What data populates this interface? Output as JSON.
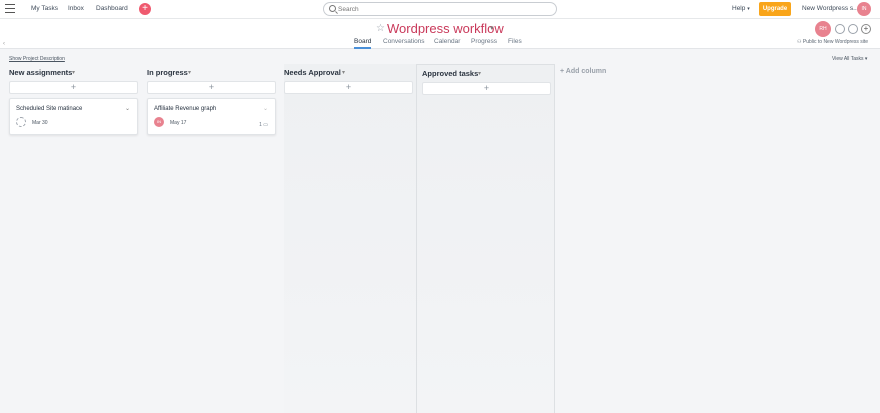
{
  "topbar": {
    "nav": [
      "My Tasks",
      "Inbox",
      "Dashboard"
    ],
    "search_placeholder": "Search",
    "help_label": "Help",
    "upgrade_label": "Upgrade",
    "workspace_label": "New Wordpress s...",
    "avatar_initials": "IN"
  },
  "project": {
    "title": "Wordpress workflow",
    "tabs": [
      "Board",
      "Conversations",
      "Calendar",
      "Progress",
      "Files"
    ],
    "active_tab": "Board",
    "member_initials": "RH",
    "public_label": "Public to New Wordpress site"
  },
  "board": {
    "show_description": "Show Project Description",
    "view_all": "View All Tasks",
    "add_column_label": "+ Add column",
    "columns": [
      {
        "title": "New assignments",
        "cards": [
          {
            "title": "Scheduled Site matinace",
            "date": "Mar 30"
          }
        ]
      },
      {
        "title": "In progress",
        "cards": [
          {
            "title": "Affiliate Revenue graph",
            "date": "May 17",
            "count": "1",
            "assignee_initials": "IN"
          }
        ]
      },
      {
        "title": "Needs Approval",
        "cards": []
      },
      {
        "title": "Approved tasks",
        "cards": []
      }
    ]
  },
  "colors": {
    "accent": "#c9395a",
    "upgrade": "#f9a51a",
    "avatar": "#e8828f",
    "tab_underline": "#4a90d9"
  }
}
